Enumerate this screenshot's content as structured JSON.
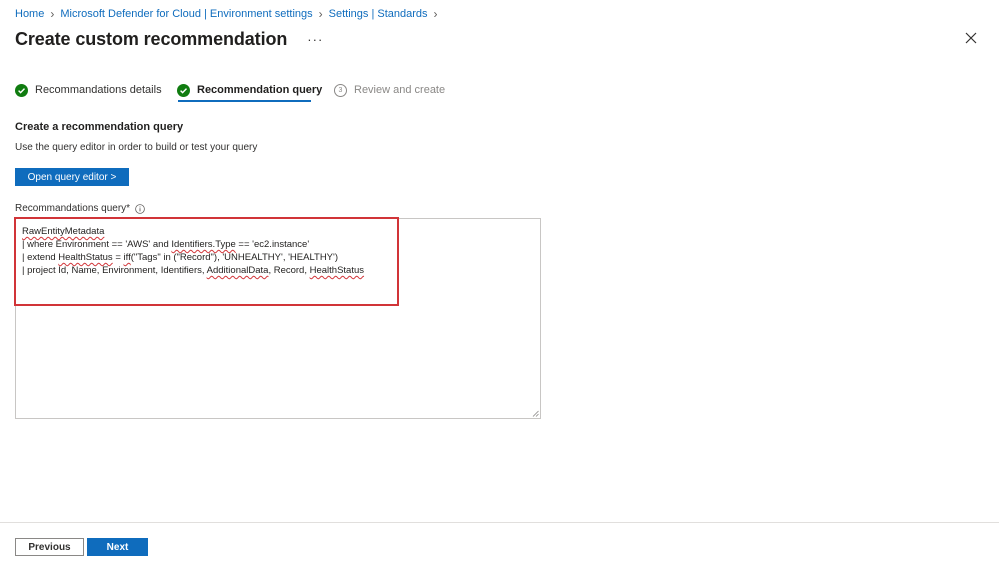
{
  "breadcrumb": [
    "Home",
    "Microsoft Defender for Cloud | Environment settings",
    "Settings | Standards"
  ],
  "page": {
    "title": "Create custom recommendation",
    "more_label": "···"
  },
  "steps": [
    {
      "label": "Recommandations details",
      "state": "done"
    },
    {
      "label": "Recommendation query",
      "state": "active"
    },
    {
      "label": "Review and create",
      "state": "pending",
      "number": "3"
    }
  ],
  "section": {
    "title": "Create a recommendation query",
    "description": "Use the query editor in order to build or test your query",
    "open_editor_label": "Open query editor >"
  },
  "query": {
    "label": "Recommandations query",
    "required_mark": " *",
    "line1": "RawEntityMetadata",
    "line2_pre": "| where Environment == 'AWS' and ",
    "line2_sq": "Identifiers.Type",
    "line2_post": " == 'ec2.instance'",
    "line3_pre": "| extend ",
    "line3_sq1": "HealthStatus",
    "line3_mid": " = ",
    "line3_sq2": "iff",
    "line3_post": "(\"Tags\" in (\"Record\"), 'UNHEALTHY', 'HEALTHY')",
    "line4_pre": "| project Id, Name, Environment, Identifiers, ",
    "line4_sq1": "AdditionalData",
    "line4_mid": ", Record, ",
    "line4_sq2": "HealthStatus"
  },
  "footer": {
    "previous_label": "Previous",
    "next_label": "Next"
  },
  "colors": {
    "accent": "#0f6cbd",
    "success": "#107c10",
    "highlight": "#d13438"
  },
  "icons": [
    "chevron-right-icon",
    "close-icon",
    "checkmark-circle-icon",
    "info-icon",
    "resize-handle-icon"
  ]
}
